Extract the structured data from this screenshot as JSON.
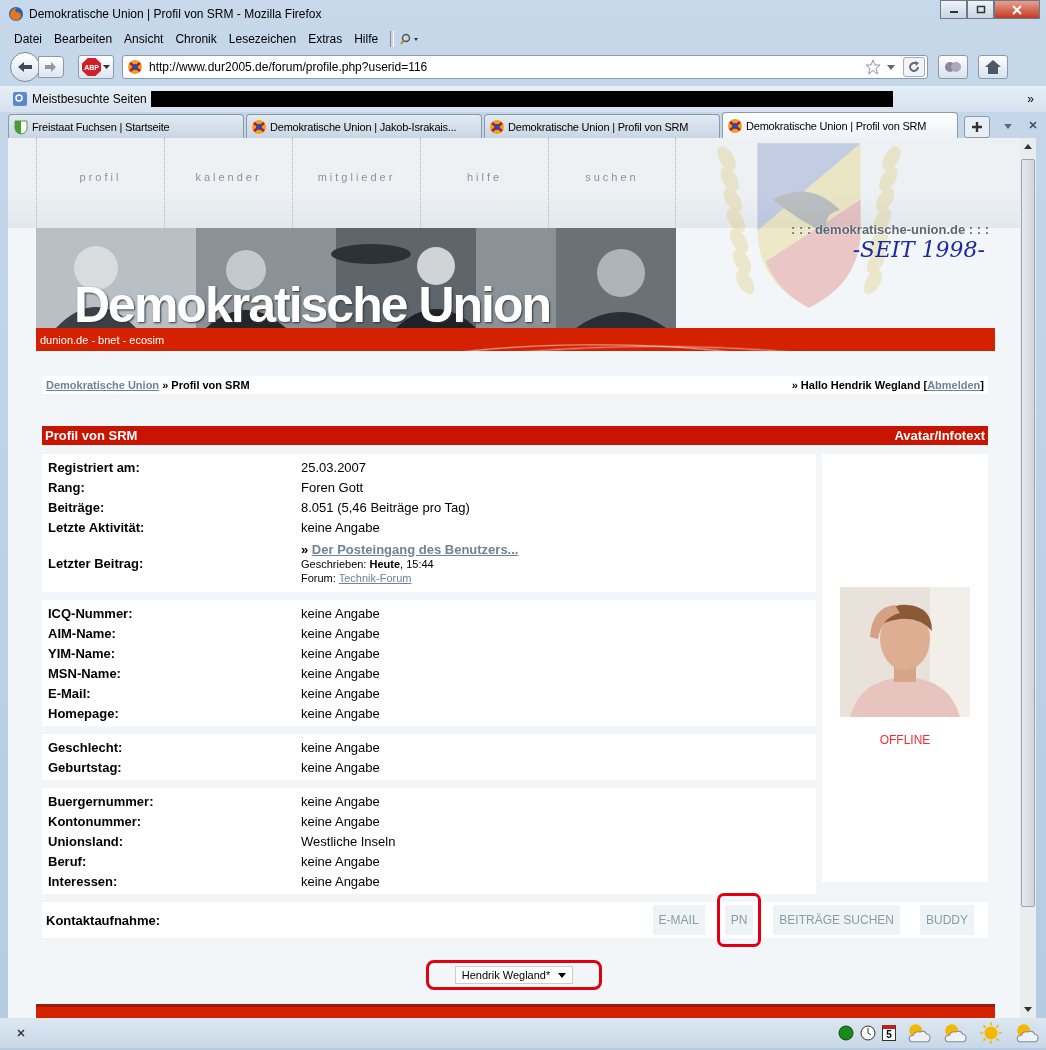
{
  "window": {
    "title": "Demokratische Union | Profil von SRM - Mozilla Firefox"
  },
  "menu": [
    "Datei",
    "Bearbeiten",
    "Ansicht",
    "Chronik",
    "Lesezeichen",
    "Extras",
    "Hilfe"
  ],
  "toolbar": {
    "adblock_label": "ABP",
    "url": "http://www.dur2005.de/forum/profile.php?userid=116"
  },
  "bookmarks": {
    "label": "Meistbesuchte Seiten",
    "overflow": "»"
  },
  "tabs": [
    {
      "label": "Freistaat Fuchsen | Startseite",
      "kind": "shield",
      "selected": false
    },
    {
      "label": "Demokratische Union | Jakob-Israkais...",
      "kind": "crest",
      "selected": false
    },
    {
      "label": "Demokratische Union | Profil von SRM",
      "kind": "crest",
      "selected": false
    },
    {
      "label": "Demokratische Union | Profil von SRM",
      "kind": "crest",
      "selected": true
    }
  ],
  "site_nav": [
    "profil",
    "kalender",
    "mitglieder",
    "hilfe",
    "suchen"
  ],
  "banner": {
    "title": "Demokratische Union",
    "tagline": ": : : demokratische-union.de : : :",
    "slogan": "-SEIT 1998-",
    "links": "dunion.de - bnet - ecosim"
  },
  "breadcrumb": {
    "home": "Demokratische Union",
    "separator": "»",
    "current": "Profil von SRM",
    "greeting": "» Hallo Hendrik Wegland [",
    "logout": "Abmelden",
    "greeting_end": "]"
  },
  "profile": {
    "title": "Profil von SRM",
    "side_title": "Avatar/Infotext",
    "status": "OFFLINE",
    "sections": [
      {
        "rows": [
          {
            "kind": "text",
            "label": "Registriert am:",
            "value": "25.03.2007"
          },
          {
            "kind": "text",
            "label": "Rang:",
            "value": "Foren Gott"
          },
          {
            "kind": "text",
            "label": "Beiträge:",
            "value": "8.051 (5,46 Beiträge pro Tag)"
          },
          {
            "kind": "text",
            "label": "Letzte Aktivität:",
            "value": "keine Angabe"
          },
          {
            "kind": "post",
            "label": "Letzter Beitrag:",
            "marker": "»",
            "title": "Der Posteingang des Benutzers...",
            "written": "Geschrieben: **Heute**, 15:44",
            "forum_label": "Forum:",
            "forum": "Technik-Forum"
          }
        ]
      },
      {
        "rows": [
          {
            "kind": "text",
            "label": "ICQ-Nummer:",
            "value": "keine Angabe"
          },
          {
            "kind": "text",
            "label": "AIM-Name:",
            "value": "keine Angabe"
          },
          {
            "kind": "text",
            "label": "YIM-Name:",
            "value": "keine Angabe"
          },
          {
            "kind": "text",
            "label": "MSN-Name:",
            "value": "keine Angabe"
          },
          {
            "kind": "text",
            "label": "E-Mail:",
            "value": "keine Angabe"
          },
          {
            "kind": "text",
            "label": "Homepage:",
            "value": "keine Angabe"
          }
        ]
      },
      {
        "rows": [
          {
            "kind": "text",
            "label": "Geschlecht:",
            "value": "keine Angabe"
          },
          {
            "kind": "text",
            "label": "Geburtstag:",
            "value": "keine Angabe"
          }
        ]
      },
      {
        "rows": [
          {
            "kind": "text",
            "label": "Buergernummer:",
            "value": "keine Angabe"
          },
          {
            "kind": "text",
            "label": "Kontonummer:",
            "value": "keine Angabe"
          },
          {
            "kind": "text",
            "label": "Unionsland:",
            "value": "Westliche Inseln"
          },
          {
            "kind": "text",
            "label": "Beruf:",
            "value": "keine Angabe"
          },
          {
            "kind": "text",
            "label": "Interessen:",
            "value": "keine Angabe"
          }
        ]
      }
    ]
  },
  "contact": {
    "label": "Kontaktaufnahme:",
    "buttons": [
      {
        "label": "E-MAIL",
        "highlighted": false
      },
      {
        "label": "PN",
        "highlighted": true
      },
      {
        "label": "BEITRÄGE SUCHEN",
        "highlighted": false
      },
      {
        "label": "BUDDY",
        "highlighted": false
      }
    ]
  },
  "user_select": {
    "value": "Hendrik Wegland*",
    "highlighted": true
  },
  "status_bar": {
    "calendar_day": "5"
  }
}
